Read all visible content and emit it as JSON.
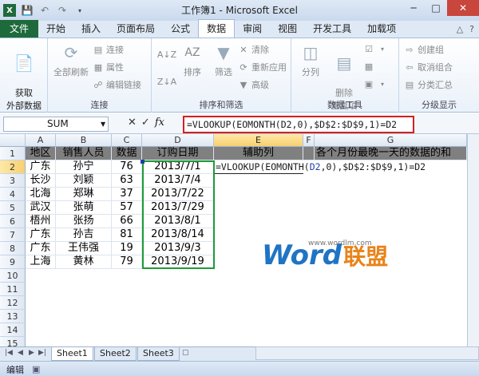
{
  "window": {
    "title": "工作簿1 - Microsoft Excel",
    "controls": {
      "minimize": "─",
      "maximize": "□",
      "close": "✕"
    }
  },
  "tabs": [
    {
      "label": "文件",
      "active": false
    },
    {
      "label": "开始",
      "active": false
    },
    {
      "label": "插入",
      "active": false
    },
    {
      "label": "页面布局",
      "active": false
    },
    {
      "label": "公式",
      "active": false
    },
    {
      "label": "数据",
      "active": true
    },
    {
      "label": "审阅",
      "active": false
    },
    {
      "label": "视图",
      "active": false
    },
    {
      "label": "开发工具",
      "active": false
    },
    {
      "label": "加载项",
      "active": false
    }
  ],
  "ribbon": {
    "get_external": "获取\n外部数据",
    "connections": {
      "refresh_all": "全部刷新",
      "connections": "连接",
      "properties": "属性",
      "edit_links": "编辑链接",
      "label": "连接"
    },
    "sort_filter": {
      "sort": "排序",
      "filter": "筛选",
      "clear": "清除",
      "reapply": "重新应用",
      "advanced": "高级",
      "label": "排序和筛选"
    },
    "data_tools": {
      "text_to_columns": "分列",
      "remove_duplicates": "删除\n重复项",
      "label": "数据工具"
    },
    "outline": {
      "group": "创建组",
      "ungroup": "取消组合",
      "subtotal": "分类汇总",
      "label": "分级显示"
    }
  },
  "formula_bar": {
    "name_box": "SUM",
    "formula": "=VLOOKUP(EOMONTH(D2,0),$D$2:$D$9,1)=D2"
  },
  "columns": [
    "A",
    "B",
    "C",
    "D",
    "E",
    "F",
    "G"
  ],
  "rows": [
    "1",
    "2",
    "3",
    "4",
    "5",
    "6",
    "7",
    "8",
    "9",
    "10",
    "11",
    "12",
    "13",
    "14",
    "15"
  ],
  "headers": {
    "A": "地区",
    "B": "销售人员",
    "C": "数据",
    "D": "订购日期",
    "E": "辅助列",
    "G": "各个月份最晚一天的数据的和"
  },
  "records": [
    {
      "region": "广东",
      "person": "孙宁",
      "value": "76",
      "date": "2013/7/1"
    },
    {
      "region": "长沙",
      "person": "刘颖",
      "value": "63",
      "date": "2013/7/4"
    },
    {
      "region": "北海",
      "person": "郑琳",
      "value": "37",
      "date": "2013/7/22"
    },
    {
      "region": "武汉",
      "person": "张萌",
      "value": "57",
      "date": "2013/7/29"
    },
    {
      "region": "梧州",
      "person": "张扬",
      "value": "66",
      "date": "2013/8/1"
    },
    {
      "region": "广东",
      "person": "孙吉",
      "value": "81",
      "date": "2013/8/14"
    },
    {
      "region": "广东",
      "person": "王伟强",
      "value": "19",
      "date": "2013/9/3"
    },
    {
      "region": "上海",
      "person": "黄林",
      "value": "79",
      "date": "2013/9/19"
    }
  ],
  "edit_cell": {
    "part1": "=VLOOKUP(EOMONTH(",
    "ref": "D2",
    "part2": ",0),$D$2:$D$9,1)=D2"
  },
  "sheets": [
    "Sheet1",
    "Sheet2",
    "Sheet3"
  ],
  "status": "编辑",
  "watermark": {
    "brand": "Word",
    "brand_cn": "联盟",
    "url": "www.wordlm.com"
  },
  "colors": {
    "file_tab": "#1f6a3c",
    "header_fill": "#808080",
    "selection": "#1f9a3a",
    "formula_border": "#d42020"
  }
}
